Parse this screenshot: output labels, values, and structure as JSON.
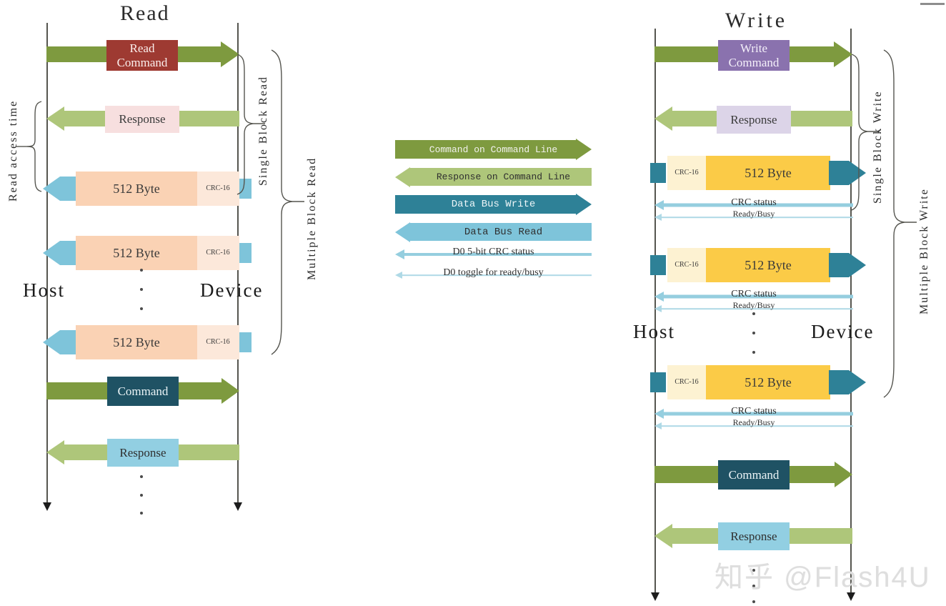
{
  "diagram": {
    "title_read": "Read",
    "title_write": "Write",
    "watermark": "知乎 @Flash4U"
  },
  "read": {
    "actor_host": "Host",
    "actor_device": "Device",
    "bracket_access": "Read access time",
    "bracket_single": "Single Block Read",
    "bracket_multiple": "Multiple Block Read",
    "rows": [
      {
        "id": "read-command",
        "label": "Read\nCommand",
        "kind": "command-out"
      },
      {
        "id": "response-1",
        "label": "Response",
        "kind": "response-in"
      },
      {
        "id": "data-block-1",
        "label": "512 Byte",
        "crc": "CRC-16",
        "kind": "data-read"
      },
      {
        "id": "data-block-2",
        "label": "512 Byte",
        "crc": "CRC-16",
        "kind": "data-read"
      },
      {
        "id": "data-block-n",
        "label": "512 Byte",
        "crc": "CRC-16",
        "kind": "data-read"
      },
      {
        "id": "stop-command",
        "label": "Command",
        "kind": "command-out"
      },
      {
        "id": "response-2",
        "label": "Response",
        "kind": "response-in"
      }
    ]
  },
  "write": {
    "actor_host": "Host",
    "actor_device": "Device",
    "bracket_single": "Single Block Write",
    "bracket_multiple": "Multiple Block Write",
    "rows": [
      {
        "id": "write-command",
        "label": "Write\nCommand",
        "kind": "command-out"
      },
      {
        "id": "response-1",
        "label": "Response",
        "kind": "response-in"
      },
      {
        "id": "data-block-1",
        "label": "512 Byte",
        "crc": "CRC-16",
        "kind": "data-write"
      },
      {
        "id": "status-1",
        "label": "CRC status",
        "sub": "Ready/Busy",
        "kind": "status"
      },
      {
        "id": "data-block-2",
        "label": "512 Byte",
        "crc": "CRC-16",
        "kind": "data-write"
      },
      {
        "id": "status-2",
        "label": "CRC status",
        "sub": "Ready/Busy",
        "kind": "status"
      },
      {
        "id": "data-block-n",
        "label": "512 Byte",
        "crc": "CRC-16",
        "kind": "data-write"
      },
      {
        "id": "status-n",
        "label": "CRC status",
        "sub": "Ready/Busy",
        "kind": "status"
      },
      {
        "id": "stop-command",
        "label": "Command",
        "kind": "command-out"
      },
      {
        "id": "response-2",
        "label": "Response",
        "kind": "response-in"
      }
    ]
  },
  "legend": {
    "items": [
      {
        "id": "command-on-command-line",
        "label": "Command on Command Line",
        "dir": "right",
        "color": "#7E9A3F",
        "text_color": "#f2f2ee"
      },
      {
        "id": "response-on-command-line",
        "label": "Response on Command Line",
        "dir": "left",
        "color": "#AEC67A",
        "text_color": "#2f2f2f"
      },
      {
        "id": "data-bus-write",
        "label": "Data Bus Write",
        "dir": "right",
        "color": "#2E8197",
        "text_color": "#eef6f8"
      },
      {
        "id": "data-bus-read",
        "label": "Data Bus Read",
        "dir": "left",
        "color": "#7EC4DA",
        "text_color": "#2f2f2f"
      },
      {
        "id": "d0-crc-status",
        "label": "D0 5-bit CRC status",
        "dir": "left",
        "color": "#95CEDF",
        "text_color": "#2f2f2f"
      },
      {
        "id": "d0-toggle-ready-busy",
        "label": "D0 toggle for ready/busy",
        "dir": "left",
        "color": "#AFD9E6",
        "text_color": "#2f2f2f"
      }
    ]
  },
  "colors": {
    "command_green": "#7E9A3F",
    "response_green": "#AEC67A",
    "data_read_blue": "#7EC4DA",
    "data_write_teal": "#2E8197",
    "read_command_box": "#9E3A32",
    "write_command_box": "#8A72AE",
    "response_pink": "#F7DFDF",
    "response_lilac": "#DCD4E8",
    "response_skyblue": "#92CFE2",
    "command_navy": "#1F5264",
    "block_peach": "#FAD2B4",
    "block_peach_light": "#FCE8DA",
    "block_yellow": "#FBCB47",
    "block_yellow_light": "#FDF2D2",
    "lifeline": "#55554f"
  }
}
